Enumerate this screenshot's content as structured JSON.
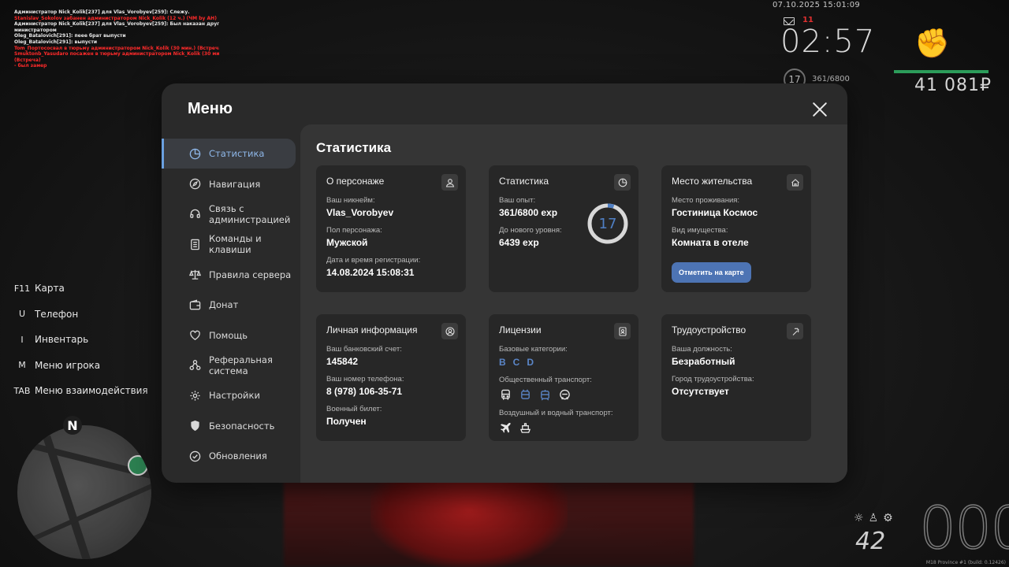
{
  "chat": [
    {
      "text": "Администратор Nick_Kolik[237] для Vlas_Vorobyev[259]: Слежу.",
      "color": "w"
    },
    {
      "text": "Stanislav_Sokolov забанен администратором Nick_Kolik (12 ч.) (ЧМ by АН)",
      "color": "r"
    },
    {
      "text": "Администратор Nick_Kolik[237] для Vlas_Vorobyev[259]: Был наказан другим ад",
      "color": "w"
    },
    {
      "text": "министратором",
      "color": "w"
    },
    {
      "text": "Oleg_Batalovich[291]: пеее брат выпусти",
      "color": "w"
    },
    {
      "text": "Oleg_Batalovich[291]: выпусти",
      "color": "w"
    },
    {
      "text": "Tom_Портососвал в тюрьму администратором Nick_Kolik (30 мин.) (Встреча)",
      "color": "r"
    },
    {
      "text": "Smuktonb_Yasudaro посажен в тюрьму администратором Nick_Kolik (30 мин.)",
      "color": "r"
    },
    {
      "text": "(Встреча)",
      "color": "r"
    },
    {
      "text": " - был замер",
      "color": "r"
    }
  ],
  "hud": {
    "date": "07.10.2025 15:01:09",
    "notif_count": "11",
    "time": "02:57",
    "level": "17",
    "exp": "361/6800",
    "money": "41 081₽"
  },
  "keybinds": [
    {
      "key": "F11",
      "label": "Карта"
    },
    {
      "key": "U",
      "label": "Телефон"
    },
    {
      "key": "I",
      "label": "Инвентарь"
    },
    {
      "key": "M",
      "label": "Меню игрока"
    },
    {
      "key": "TAB",
      "label": "Меню взаимодействия"
    }
  ],
  "minimap": {
    "north": "N"
  },
  "speedo": {
    "speed": "000",
    "fuel": "42"
  },
  "build": "M18 Province #1 (build: 0.12426)",
  "menu": {
    "title": "Меню",
    "sidebar": [
      {
        "label": "Статистика",
        "icon": "pie-chart-icon"
      },
      {
        "label": "Навигация",
        "icon": "compass-icon"
      },
      {
        "label": "Связь с администрацией",
        "icon": "headset-icon"
      },
      {
        "label": "Команды и клавиши",
        "icon": "document-icon"
      },
      {
        "label": "Правила сервера",
        "icon": "scales-icon"
      },
      {
        "label": "Донат",
        "icon": "wallet-icon"
      },
      {
        "label": "Помощь",
        "icon": "heart-hand-icon"
      },
      {
        "label": "Реферальная система",
        "icon": "network-icon"
      },
      {
        "label": "Настройки",
        "icon": "gear-icon"
      },
      {
        "label": "Безопасность",
        "icon": "shield-icon"
      },
      {
        "label": "Обновления",
        "icon": "check-circle-icon"
      }
    ],
    "content_title": "Статистика",
    "about": {
      "title": "О персонаже",
      "nick_label": "Ваш никнейм:",
      "nick": "Vlas_Vorobyev",
      "gender_label": "Пол персонажа:",
      "gender": "Мужской",
      "reg_label": "Дата и время регистрации:",
      "reg": "14.08.2024 15:08:31"
    },
    "stats": {
      "title": "Статистика",
      "exp_label": "Ваш опыт:",
      "exp": "361/6800 exp",
      "next_label": "До нового уровня:",
      "next": "6439 exp",
      "level": "17",
      "progress": 0.053
    },
    "residence": {
      "title": "Место жительства",
      "place_label": "Место проживания:",
      "place": "Гостиница Космос",
      "type_label": "Вид имущества:",
      "type": "Комната в отеле",
      "button": "Отметить на карте"
    },
    "personal": {
      "title": "Личная информация",
      "bank_label": "Ваш банковский счет:",
      "bank": "145842",
      "phone_label": "Ваш номер телефона:",
      "phone": "8 (978) 106-35-71",
      "military_label": "Военный билет:",
      "military": "Получен"
    },
    "licenses": {
      "title": "Лицензии",
      "basic_label": "Базовые категории:",
      "categories": [
        "B",
        "C",
        "D"
      ],
      "public_label": "Общественный транспорт:",
      "air_label": "Воздушный и водный транспорт:"
    },
    "employment": {
      "title": "Трудоустройство",
      "position_label": "Ваша должность:",
      "position": "Безработный",
      "city_label": "Город трудоустройства:",
      "city": "Отсутствует"
    }
  }
}
